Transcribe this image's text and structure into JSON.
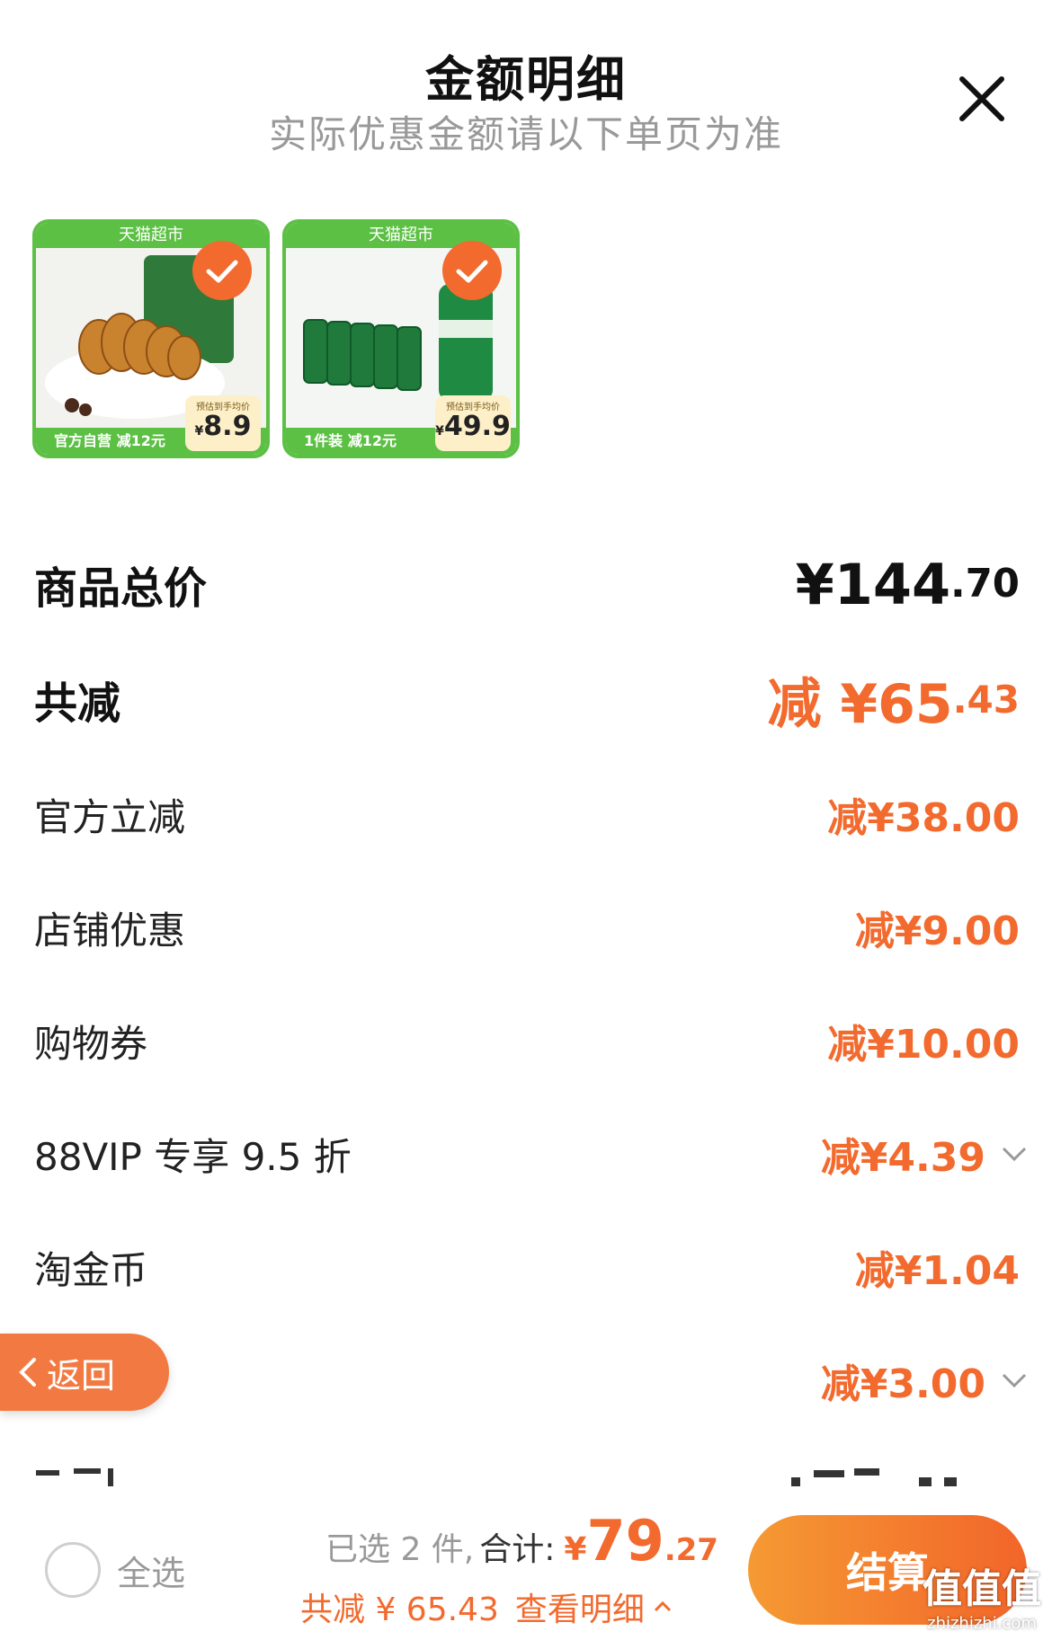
{
  "header": {
    "title": "金额明细",
    "subtitle": "实际优惠金额请以下单页为准"
  },
  "products": [
    {
      "store": "天猫超市",
      "bottom_text": "官方自营  减12元",
      "price_caption": "预估到手均价",
      "price_yen": "¥",
      "price_value": "8.9",
      "checked": true
    },
    {
      "store": "天猫超市",
      "bottom_text": "1件装  减12元",
      "price_caption": "预估到手均价",
      "price_yen": "¥",
      "price_value": "49.9",
      "checked": true
    }
  ],
  "rows": {
    "total": {
      "label": "商品总价",
      "yen_int": "¥144",
      "dec": ".70"
    },
    "reduce": {
      "label": "共减",
      "int": "减 ¥65",
      "dec": ".43"
    },
    "official": {
      "label": "官方立减",
      "amount": "减¥38.00"
    },
    "shop": {
      "label": "店铺优惠",
      "amount": "减¥9.00"
    },
    "coupon": {
      "label": "购物券",
      "amount": "减¥10.00"
    },
    "vip": {
      "label": "88VIP 专享 9.5 折",
      "amount": "减¥4.39"
    },
    "coin": {
      "label": "淘金币",
      "amount": "减¥1.04"
    },
    "other": {
      "amount": "减¥3.00"
    }
  },
  "back_button": {
    "label": "返回"
  },
  "footer": {
    "select_all": "全选",
    "selected": "已选 2 件,",
    "total_label": "合计:",
    "total_yen": "¥",
    "total_int": "79",
    "total_dec": ".27",
    "reduce_label": "共减 ¥ 65.43",
    "detail_link": "查看明细",
    "checkout": "结算"
  },
  "watermark": {
    "main": "值值值",
    "sub": "zhizhizhi.com"
  },
  "colors": {
    "accent": "#f26a2e",
    "green": "#5cc044"
  }
}
